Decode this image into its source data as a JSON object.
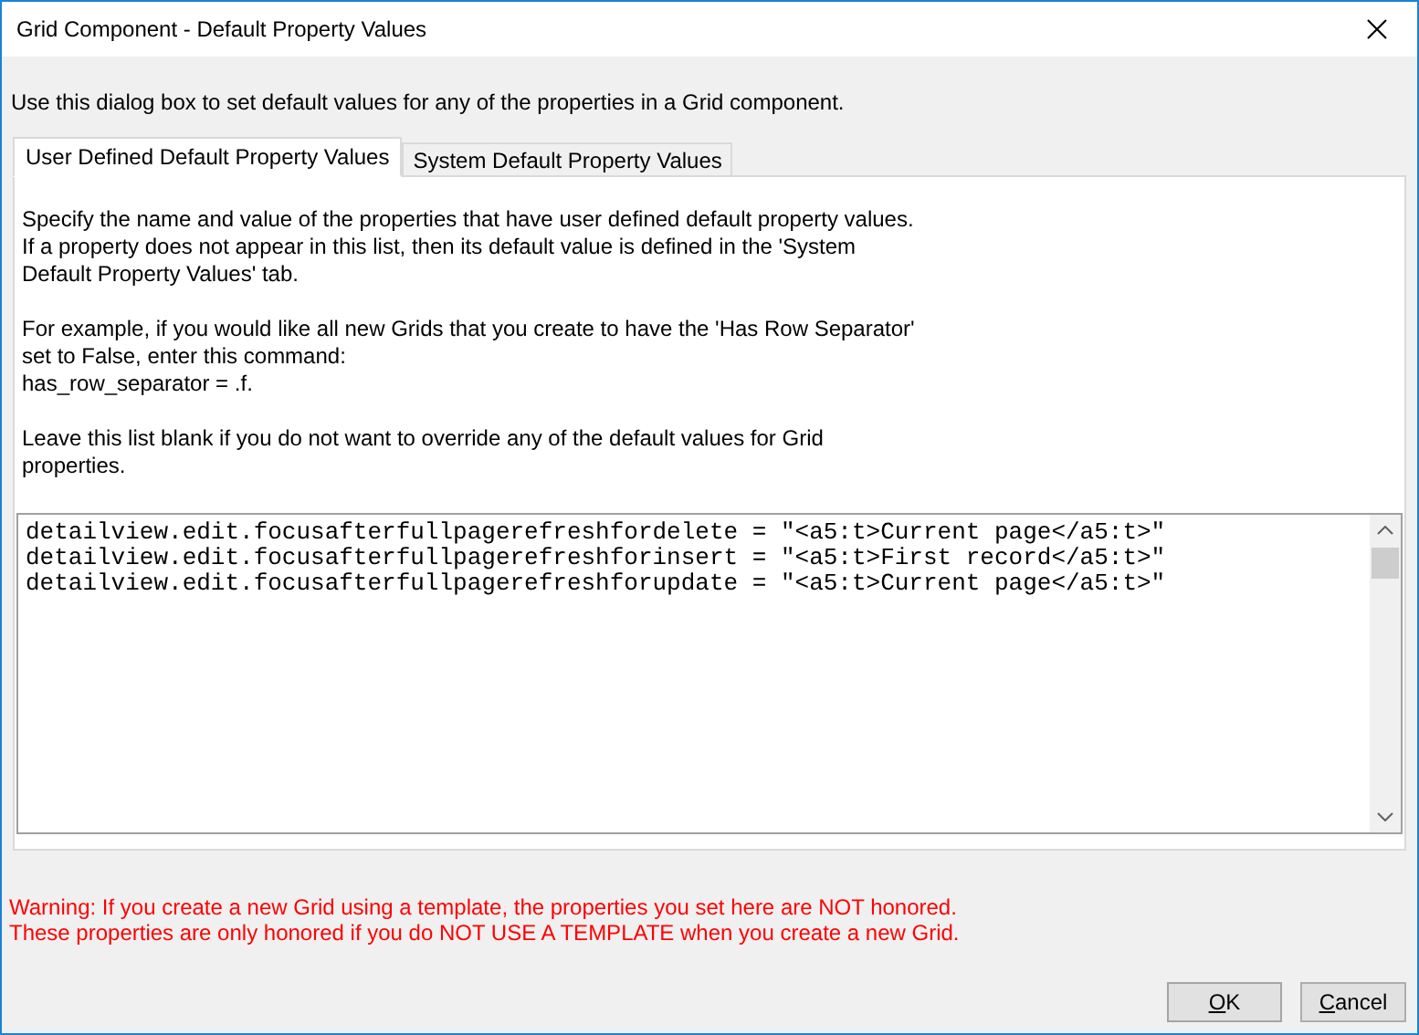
{
  "window": {
    "title": "Grid Component - Default Property Values"
  },
  "intro": "Use this dialog box to set default values for any of the properties in a Grid component.",
  "tabs": [
    {
      "label": "User Defined Default Property Values",
      "selected": true
    },
    {
      "label": "System Default Property Values",
      "selected": false
    }
  ],
  "panel": {
    "paragraphs": [
      "Specify the name and value of the properties that have user defined default property values. If a property does not appear in this list, then its default value is defined in the 'System Default Property Values' tab.",
      "For example, if you would like all new Grids that you create to have the 'Has Row Separator' set to False, enter this command:\nhas_row_separator = .f.",
      "Leave this list blank if you do not want to override any of the default values for Grid properties."
    ],
    "editor_lines": [
      "detailview.edit.focusafterfullpagerefreshfordelete = \"<a5:t>Current page</a5:t>\"",
      "detailview.edit.focusafterfullpagerefreshforinsert = \"<a5:t>First record</a5:t>\"",
      "detailview.edit.focusafterfullpagerefreshforupdate = \"<a5:t>Current page</a5:t>\""
    ]
  },
  "warning": [
    "Warning: If you create a new Grid using a template, the properties you set here are NOT honored.",
    "These properties are only honored if you do NOT USE A TEMPLATE when you create a new Grid."
  ],
  "buttons": [
    {
      "label": "OK",
      "kind": "default"
    },
    {
      "label": "Cancel",
      "kind": "normal"
    }
  ]
}
